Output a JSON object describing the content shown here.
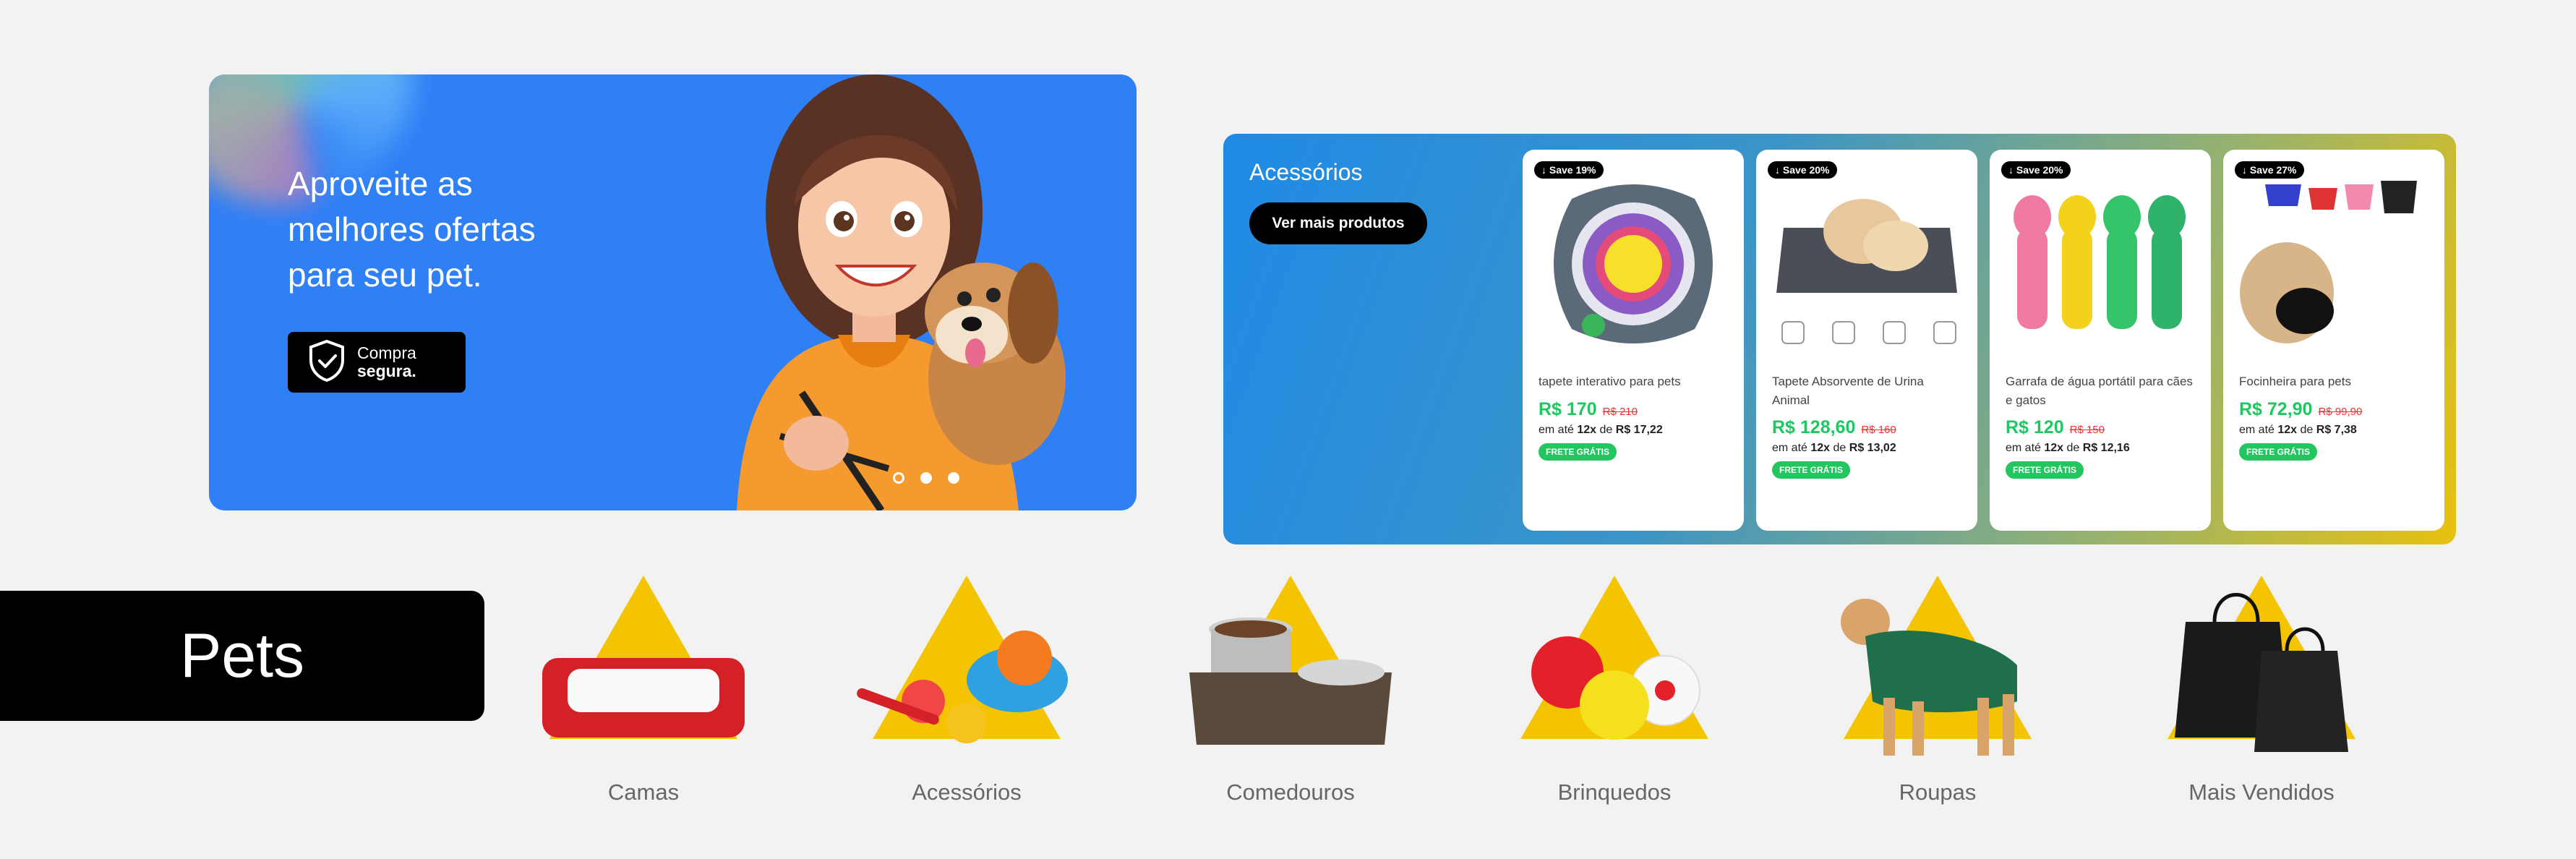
{
  "hero": {
    "headline": "Aproveite as\nmelhores ofertas\npara seu pet.",
    "badge_line1": "Compra",
    "badge_line2": "segura.",
    "slides": 3,
    "active_slide": 1
  },
  "strip": {
    "title": "Acessórios",
    "cta": "Ver mais produtos",
    "products": [
      {
        "save": "↓ Save 19%",
        "name": "tapete interativo para pets",
        "price": "R$ 170",
        "old_price": "R$ 210",
        "inst_prefix": "em até",
        "inst_count": "12x",
        "inst_de": "de",
        "inst_value": "R$ 17,22",
        "shipping": "FRETE GRÁTIS"
      },
      {
        "save": "↓ Save 20%",
        "name": "Tapete Absorvente de Urina Animal",
        "price": "R$ 128,60",
        "old_price": "R$ 160",
        "inst_prefix": "em até",
        "inst_count": "12x",
        "inst_de": "de",
        "inst_value": "R$ 13,02",
        "shipping": "FRETE GRÁTIS"
      },
      {
        "save": "↓ Save 20%",
        "name": "Garrafa de água portátil para cães e gatos",
        "price": "R$ 120",
        "old_price": "R$ 150",
        "inst_prefix": "em até",
        "inst_count": "12x",
        "inst_de": "de",
        "inst_value": "R$ 12,16",
        "shipping": "FRETE GRÁTIS"
      },
      {
        "save": "↓ Save 27%",
        "name": "Focinheira para pets",
        "price": "R$ 72,90",
        "old_price": "R$ 99,90",
        "inst_prefix": "em até",
        "inst_count": "12x",
        "inst_de": "de",
        "inst_value": "R$ 7,38",
        "shipping": "FRETE GRÁTIS"
      }
    ]
  },
  "categories": {
    "section_label": "Pets",
    "items": [
      {
        "label": "Camas",
        "icon": "pet-bed-icon"
      },
      {
        "label": "Acessórios",
        "icon": "pet-accessories-icon"
      },
      {
        "label": "Comedouros",
        "icon": "pet-feeder-icon"
      },
      {
        "label": "Brinquedos",
        "icon": "pet-toys-icon"
      },
      {
        "label": "Roupas",
        "icon": "pet-clothes-icon"
      },
      {
        "label": "Mais Vendidos",
        "icon": "shopping-bags-icon"
      }
    ]
  },
  "colors": {
    "hero_bg": "#2f7ff5",
    "price_green": "#1ec760",
    "old_price_red": "#e33333",
    "triangle_yellow": "#f5c400"
  }
}
